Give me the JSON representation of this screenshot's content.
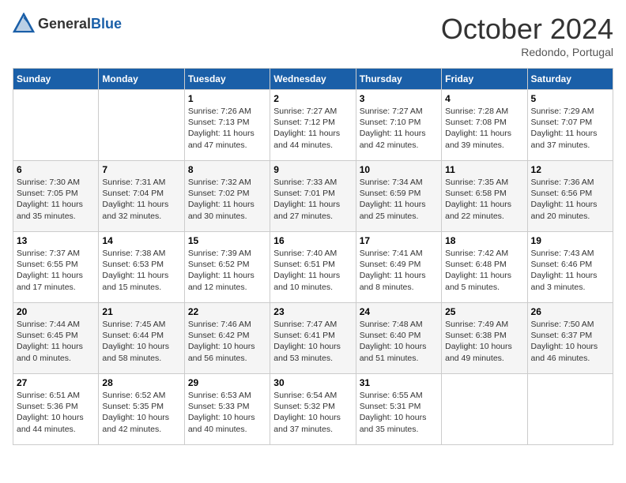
{
  "header": {
    "logo": {
      "general": "General",
      "blue": "Blue",
      "icon_title": "GeneralBlue logo"
    },
    "title": "October 2024",
    "subtitle": "Redondo, Portugal"
  },
  "weekdays": [
    "Sunday",
    "Monday",
    "Tuesday",
    "Wednesday",
    "Thursday",
    "Friday",
    "Saturday"
  ],
  "weeks": [
    [
      {
        "day": null,
        "info": null
      },
      {
        "day": null,
        "info": null
      },
      {
        "day": "1",
        "info": "Sunrise: 7:26 AM\nSunset: 7:13 PM\nDaylight: 11 hours and 47 minutes."
      },
      {
        "day": "2",
        "info": "Sunrise: 7:27 AM\nSunset: 7:12 PM\nDaylight: 11 hours and 44 minutes."
      },
      {
        "day": "3",
        "info": "Sunrise: 7:27 AM\nSunset: 7:10 PM\nDaylight: 11 hours and 42 minutes."
      },
      {
        "day": "4",
        "info": "Sunrise: 7:28 AM\nSunset: 7:08 PM\nDaylight: 11 hours and 39 minutes."
      },
      {
        "day": "5",
        "info": "Sunrise: 7:29 AM\nSunset: 7:07 PM\nDaylight: 11 hours and 37 minutes."
      }
    ],
    [
      {
        "day": "6",
        "info": "Sunrise: 7:30 AM\nSunset: 7:05 PM\nDaylight: 11 hours and 35 minutes."
      },
      {
        "day": "7",
        "info": "Sunrise: 7:31 AM\nSunset: 7:04 PM\nDaylight: 11 hours and 32 minutes."
      },
      {
        "day": "8",
        "info": "Sunrise: 7:32 AM\nSunset: 7:02 PM\nDaylight: 11 hours and 30 minutes."
      },
      {
        "day": "9",
        "info": "Sunrise: 7:33 AM\nSunset: 7:01 PM\nDaylight: 11 hours and 27 minutes."
      },
      {
        "day": "10",
        "info": "Sunrise: 7:34 AM\nSunset: 6:59 PM\nDaylight: 11 hours and 25 minutes."
      },
      {
        "day": "11",
        "info": "Sunrise: 7:35 AM\nSunset: 6:58 PM\nDaylight: 11 hours and 22 minutes."
      },
      {
        "day": "12",
        "info": "Sunrise: 7:36 AM\nSunset: 6:56 PM\nDaylight: 11 hours and 20 minutes."
      }
    ],
    [
      {
        "day": "13",
        "info": "Sunrise: 7:37 AM\nSunset: 6:55 PM\nDaylight: 11 hours and 17 minutes."
      },
      {
        "day": "14",
        "info": "Sunrise: 7:38 AM\nSunset: 6:53 PM\nDaylight: 11 hours and 15 minutes."
      },
      {
        "day": "15",
        "info": "Sunrise: 7:39 AM\nSunset: 6:52 PM\nDaylight: 11 hours and 12 minutes."
      },
      {
        "day": "16",
        "info": "Sunrise: 7:40 AM\nSunset: 6:51 PM\nDaylight: 11 hours and 10 minutes."
      },
      {
        "day": "17",
        "info": "Sunrise: 7:41 AM\nSunset: 6:49 PM\nDaylight: 11 hours and 8 minutes."
      },
      {
        "day": "18",
        "info": "Sunrise: 7:42 AM\nSunset: 6:48 PM\nDaylight: 11 hours and 5 minutes."
      },
      {
        "day": "19",
        "info": "Sunrise: 7:43 AM\nSunset: 6:46 PM\nDaylight: 11 hours and 3 minutes."
      }
    ],
    [
      {
        "day": "20",
        "info": "Sunrise: 7:44 AM\nSunset: 6:45 PM\nDaylight: 11 hours and 0 minutes."
      },
      {
        "day": "21",
        "info": "Sunrise: 7:45 AM\nSunset: 6:44 PM\nDaylight: 10 hours and 58 minutes."
      },
      {
        "day": "22",
        "info": "Sunrise: 7:46 AM\nSunset: 6:42 PM\nDaylight: 10 hours and 56 minutes."
      },
      {
        "day": "23",
        "info": "Sunrise: 7:47 AM\nSunset: 6:41 PM\nDaylight: 10 hours and 53 minutes."
      },
      {
        "day": "24",
        "info": "Sunrise: 7:48 AM\nSunset: 6:40 PM\nDaylight: 10 hours and 51 minutes."
      },
      {
        "day": "25",
        "info": "Sunrise: 7:49 AM\nSunset: 6:38 PM\nDaylight: 10 hours and 49 minutes."
      },
      {
        "day": "26",
        "info": "Sunrise: 7:50 AM\nSunset: 6:37 PM\nDaylight: 10 hours and 46 minutes."
      }
    ],
    [
      {
        "day": "27",
        "info": "Sunrise: 6:51 AM\nSunset: 5:36 PM\nDaylight: 10 hours and 44 minutes."
      },
      {
        "day": "28",
        "info": "Sunrise: 6:52 AM\nSunset: 5:35 PM\nDaylight: 10 hours and 42 minutes."
      },
      {
        "day": "29",
        "info": "Sunrise: 6:53 AM\nSunset: 5:33 PM\nDaylight: 10 hours and 40 minutes."
      },
      {
        "day": "30",
        "info": "Sunrise: 6:54 AM\nSunset: 5:32 PM\nDaylight: 10 hours and 37 minutes."
      },
      {
        "day": "31",
        "info": "Sunrise: 6:55 AM\nSunset: 5:31 PM\nDaylight: 10 hours and 35 minutes."
      },
      {
        "day": null,
        "info": null
      },
      {
        "day": null,
        "info": null
      }
    ]
  ]
}
